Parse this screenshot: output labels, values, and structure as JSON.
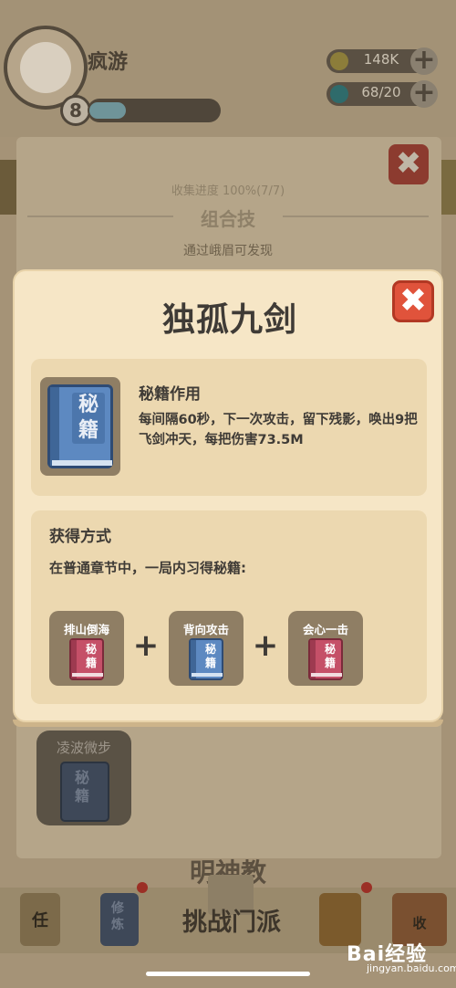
{
  "header": {
    "player_name": "疯游",
    "level": "8",
    "coins": "148K",
    "gems": "68/20"
  },
  "background": {
    "progress_text": "收集进度 100%(7/7)",
    "combo_section": "组合技",
    "combo_hint": "通过峨眉可发现",
    "card_label": "凌波微步",
    "card_book_text": "秘籍",
    "sect_name": "明神教"
  },
  "bottom_nav": {
    "task_label": "任",
    "train_label": "修炼",
    "challenge_label": "挑战门派",
    "collect_label": "收"
  },
  "modal": {
    "title": "独孤九剑",
    "effect_heading": "秘籍作用",
    "effect_text": "每间隔60秒，下一次攻击，留下残影，唤出9把飞剑冲天，每把伤害73.5M",
    "book_text": "秘籍",
    "acquire_heading": "获得方式",
    "acquire_text": "在普通章节中，一局内习得秘籍:",
    "recipe": [
      {
        "label": "排山倒海",
        "book_text": "秘籍",
        "color": "red"
      },
      {
        "label": "背向攻击",
        "book_text": "秘籍",
        "color": "blue"
      },
      {
        "label": "会心一击",
        "book_text": "秘籍",
        "color": "red"
      }
    ],
    "plus": "+"
  },
  "watermark": {
    "brand": "Bai经验",
    "url": "jingyan.baidu.com"
  },
  "colors": {
    "modal_bg": "#f6e6c6",
    "close_red": "#e0533b",
    "book_blue": "#5d89c1",
    "book_red": "#c55068"
  }
}
